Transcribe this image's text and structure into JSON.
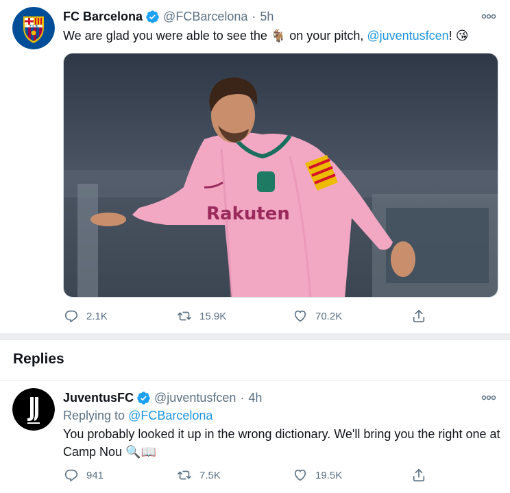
{
  "main_tweet": {
    "display_name": "FC Barcelona",
    "handle": "@FCBarcelona",
    "separator": "·",
    "time": "5h",
    "text_before": "We are glad you were able to see the ",
    "emoji_goat": "🐐",
    "text_middle": " on your pitch, ",
    "mention": "@juventusfcen",
    "text_after": "! ",
    "emoji_kiss": "😘",
    "photo_jersey_text": "Rakuten",
    "replies_count": "2.1K",
    "retweets_count": "15.9K",
    "likes_count": "70.2K"
  },
  "replies_section": {
    "title": "Replies"
  },
  "reply_tweet": {
    "display_name": "JuventusFC",
    "handle": "@juventusfcen",
    "separator": "·",
    "time": "4h",
    "replying_to_label": "Replying to ",
    "replying_to_handle": "@FCBarcelona",
    "text": "You probably looked it up in the wrong dictionary. We'll bring you the right one at Camp Nou ",
    "emoji_search": "🔍",
    "emoji_book": "📖",
    "replies_count": "941",
    "retweets_count": "7.5K",
    "likes_count": "19.5K"
  },
  "colors": {
    "accent": "#1da1f2",
    "mention": "#1b95e0",
    "secondary_text": "#5b7083",
    "barca_blue": "#004d98",
    "barca_red": "#a50044",
    "barca_yellow": "#edbb00",
    "jersey_pink": "#f2a7c3"
  },
  "icons": {
    "verified": "verified-badge-icon",
    "more": "more-options-icon",
    "reply": "reply-icon",
    "retweet": "retweet-icon",
    "like": "heart-icon",
    "share": "share-icon"
  }
}
